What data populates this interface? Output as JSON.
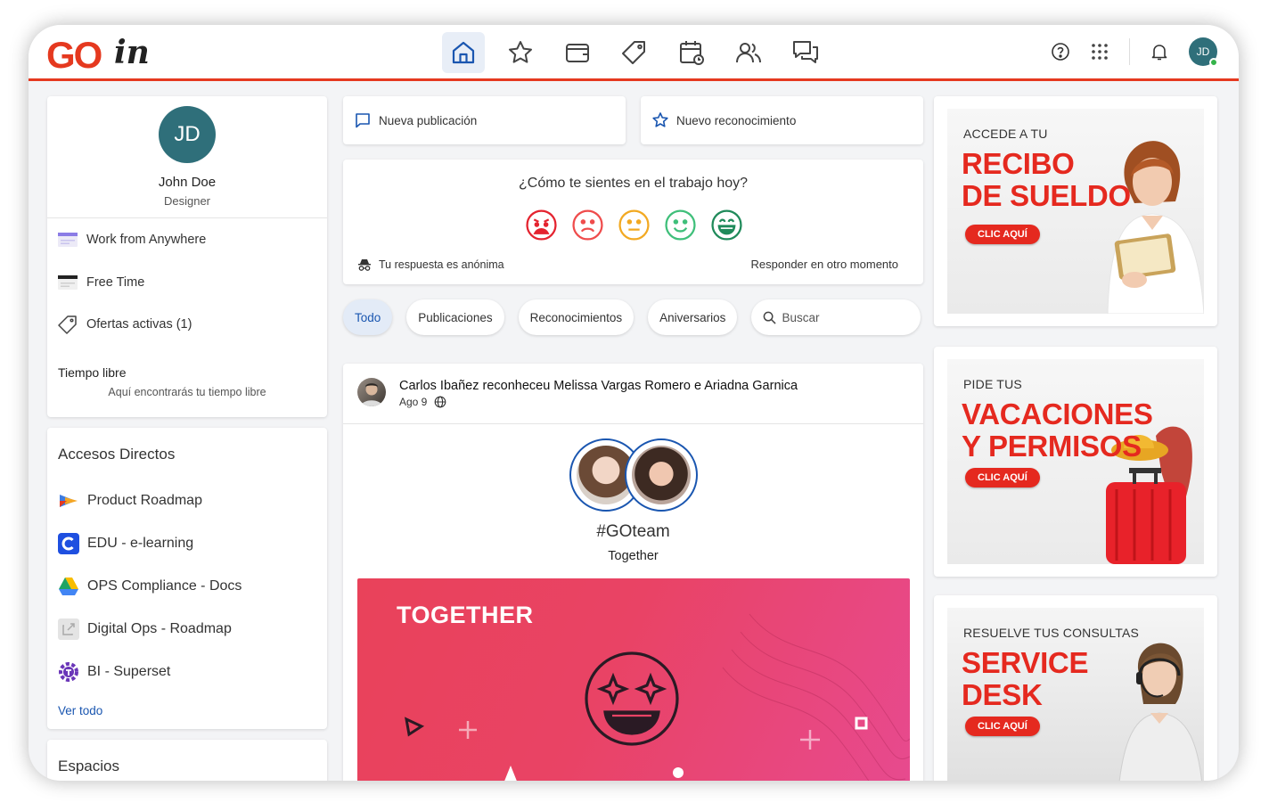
{
  "brand": {
    "logo_text_bold": "GO",
    "logo_text_script": "in",
    "accent": "#e5391f",
    "primary": "#1a56b0"
  },
  "topnav": {
    "items": [
      "home-icon",
      "star-icon",
      "wallet-icon",
      "tag-icon",
      "calendar-icon",
      "people-icon",
      "chat-icon"
    ],
    "active": "home-icon"
  },
  "topright": {
    "avatar_initials": "JD"
  },
  "profile": {
    "initials": "JD",
    "name": "John Doe",
    "role": "Designer",
    "items": [
      {
        "label": "Work from Anywhere",
        "icon": "calendar-flag-icon"
      },
      {
        "label": "Free Time",
        "icon": "calendar-flag-icon"
      },
      {
        "label": "Ofertas activas (1)",
        "icon": "tag-icon"
      }
    ],
    "free_time_title": "Tiempo libre",
    "free_time_sub": "Aquí encontrarás tu tiempo libre"
  },
  "shortcuts": {
    "title": "Accesos Directos",
    "items": [
      {
        "label": "Product Roadmap",
        "icon": "roadmap-icon"
      },
      {
        "label": "EDU - e-learning",
        "icon": "elearning-icon"
      },
      {
        "label": "OPS Compliance - Docs",
        "icon": "drive-icon"
      },
      {
        "label": "Digital Ops - Roadmap",
        "icon": "external-link-icon"
      },
      {
        "label": "BI - Superset",
        "icon": "superset-icon"
      }
    ],
    "see_all": "Ver todo"
  },
  "spaces": {
    "title": "Espacios"
  },
  "composer": {
    "new_post": "Nueva publicación",
    "new_recognition": "Nuevo reconocimiento"
  },
  "mood": {
    "question": "¿Cómo te sientes en el trabajo hoy?",
    "faces": [
      "angry-face-icon",
      "sad-face-icon",
      "neutral-face-icon",
      "smile-face-icon",
      "happy-face-icon"
    ],
    "anonymous": "Tu respuesta es anónima",
    "later": "Responder en otro momento"
  },
  "filters": {
    "chips": [
      "Todo",
      "Publicaciones",
      "Reconocimientos",
      "Aniversarios"
    ],
    "active": "Todo",
    "search_placeholder": "Buscar"
  },
  "feed": {
    "post": {
      "title": "Carlos Ibañez reconheceu Melissa Vargas Romero e Ariadna Garnica",
      "date": "Ago 9",
      "hashtag": "#GOteam",
      "subtitle": "Together",
      "banner_title": "TOGETHER"
    }
  },
  "ads": [
    {
      "kicker": "ACCEDE A TU",
      "line1": "RECIBO",
      "line2": "DE SUELDO",
      "button": "CLIC AQUÍ"
    },
    {
      "kicker": "PIDE TUS",
      "line1": "VACACIONES",
      "line2": "Y PERMISOS",
      "button": "CLIC AQUÍ"
    },
    {
      "kicker": "RESUELVE TUS CONSULTAS",
      "line1": "SERVICE",
      "line2": "DESK",
      "button": "CLIC AQUÍ"
    }
  ]
}
